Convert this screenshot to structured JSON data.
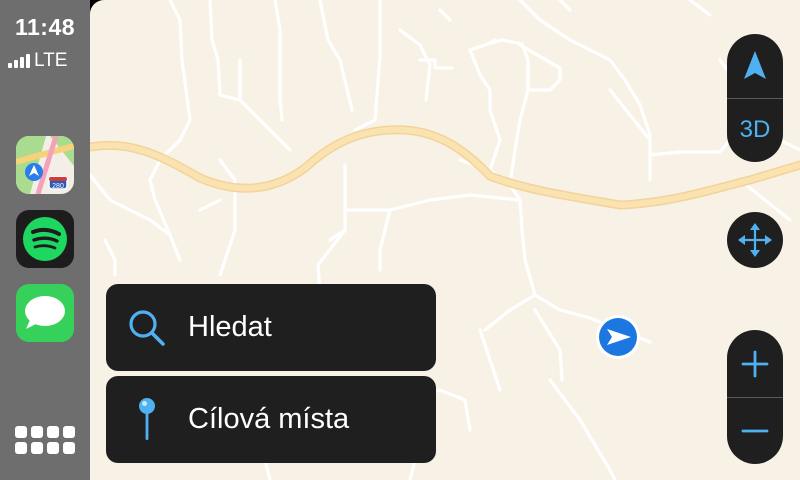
{
  "status": {
    "time": "11:48",
    "network": "LTE"
  },
  "dock": {
    "apps": [
      {
        "name": "Maps",
        "icon": "maps-icon"
      },
      {
        "name": "Spotify",
        "icon": "spotify-icon"
      },
      {
        "name": "Messages",
        "icon": "messages-icon"
      }
    ],
    "maps_shield": "280",
    "home_icon": "app-grid-icon"
  },
  "map_controls": {
    "view_3d_label": "3D",
    "compass_icon": "compass-north-icon",
    "pan_icon": "pan-arrows-icon",
    "zoom_in_icon": "plus-icon",
    "zoom_out_icon": "minus-icon"
  },
  "actions": {
    "search_label": "Hledat",
    "destinations_label": "Cílová místa"
  },
  "colors": {
    "accent": "#4fb1f2",
    "map_background": "#f8f2e6",
    "main_road": "#fbe3b1",
    "panel": "#1f1f1f",
    "sidebar": "#6e6e6e",
    "location_blue": "#1d77e0"
  }
}
